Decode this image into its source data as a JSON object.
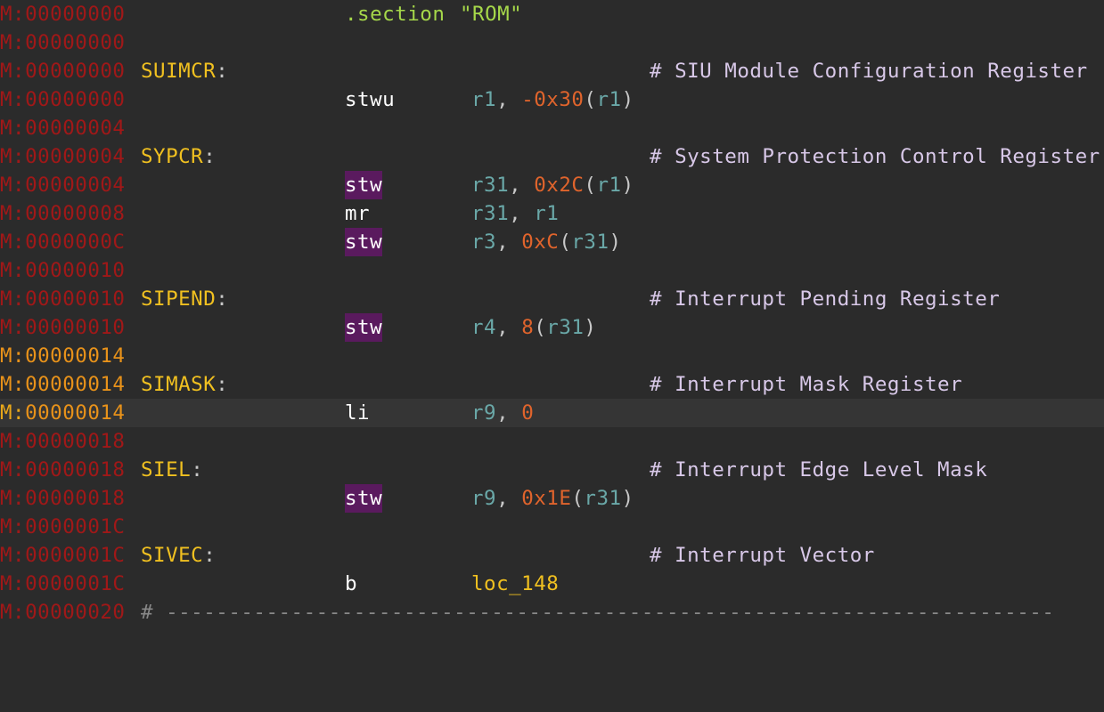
{
  "lines": [
    {
      "seg": "M:",
      "off": "00000000",
      "mnemonic": ".section",
      "operand_text": "\"ROM\""
    },
    {
      "seg": "M:",
      "off": "00000000"
    },
    {
      "seg": "M:",
      "off": "00000000",
      "label": "SUIMCR",
      "comment": "# SIU Module Configuration Register"
    },
    {
      "seg": "M:",
      "off": "00000000",
      "mnemonic": "stwu",
      "op1": "r1",
      "sep": ", ",
      "op2": "-0x30",
      "open": "(",
      "base": "r1",
      "close": ")"
    },
    {
      "seg": "M:",
      "off": "00000004"
    },
    {
      "seg": "M:",
      "off": "00000004",
      "label": "SYPCR",
      "comment": "# System Protection Control Register"
    },
    {
      "seg": "M:",
      "off": "00000004",
      "mnemonic": "stw",
      "op1": "r31",
      "sep": ", ",
      "op2": "0x2C",
      "open": "(",
      "base": "r1",
      "close": ")"
    },
    {
      "seg": "M:",
      "off": "00000008",
      "mnemonic": "mr",
      "op1": "r31",
      "sep": ", ",
      "base_only": "r1"
    },
    {
      "seg": "M:",
      "off": "0000000C",
      "mnemonic": "stw",
      "op1": "r3",
      "sep": ", ",
      "op2": "0xC",
      "open": "(",
      "base": "r31",
      "close": ")"
    },
    {
      "seg": "M:",
      "off": "00000010"
    },
    {
      "seg": "M:",
      "off": "00000010",
      "label": "SIPEND",
      "comment": "# Interrupt Pending Register"
    },
    {
      "seg": "M:",
      "off": "00000010",
      "mnemonic": "stw",
      "op1": "r4",
      "sep": ", ",
      "op2": "8",
      "open": "(",
      "base": "r31",
      "close": ")"
    },
    {
      "seg": "M:",
      "off": "00000014"
    },
    {
      "seg": "M:",
      "off": "00000014",
      "label": "SIMASK",
      "comment": "# Interrupt Mask Register"
    },
    {
      "seg": "M:",
      "off": "00000014",
      "mnemonic": "li",
      "op1": "r9",
      "sep": ", ",
      "imm": "0"
    },
    {
      "seg": "M:",
      "off": "00000018"
    },
    {
      "seg": "M:",
      "off": "00000018",
      "label": "SIEL",
      "comment": "# Interrupt Edge Level Mask"
    },
    {
      "seg": "M:",
      "off": "00000018",
      "mnemonic": "stw",
      "op1": "r9",
      "sep": ", ",
      "op2": "0x1E",
      "open": "(",
      "base": "r31",
      "close": ")"
    },
    {
      "seg": "M:",
      "off": "0000001C"
    },
    {
      "seg": "M:",
      "off": "0000001C",
      "label": "SIVEC",
      "comment": "# Interrupt Vector"
    },
    {
      "seg": "M:",
      "off": "0000001C",
      "mnemonic": "b",
      "target": "loc_148"
    },
    {
      "seg": "M:",
      "off": "00000020",
      "separator": "# -----------------------------------------------------------------------"
    }
  ],
  "label_colon": ":",
  "colors": {
    "background": "#2b2b2b",
    "current_line": "#353535",
    "address": "#a01818",
    "address_current": "#e8921a",
    "label": "#f0c020",
    "register": "#6aa8a8",
    "number": "#e0642c",
    "string": "#a6d84a",
    "comment": "#d8c8e8",
    "mnemonic_highlight": "#5a1a5e"
  }
}
